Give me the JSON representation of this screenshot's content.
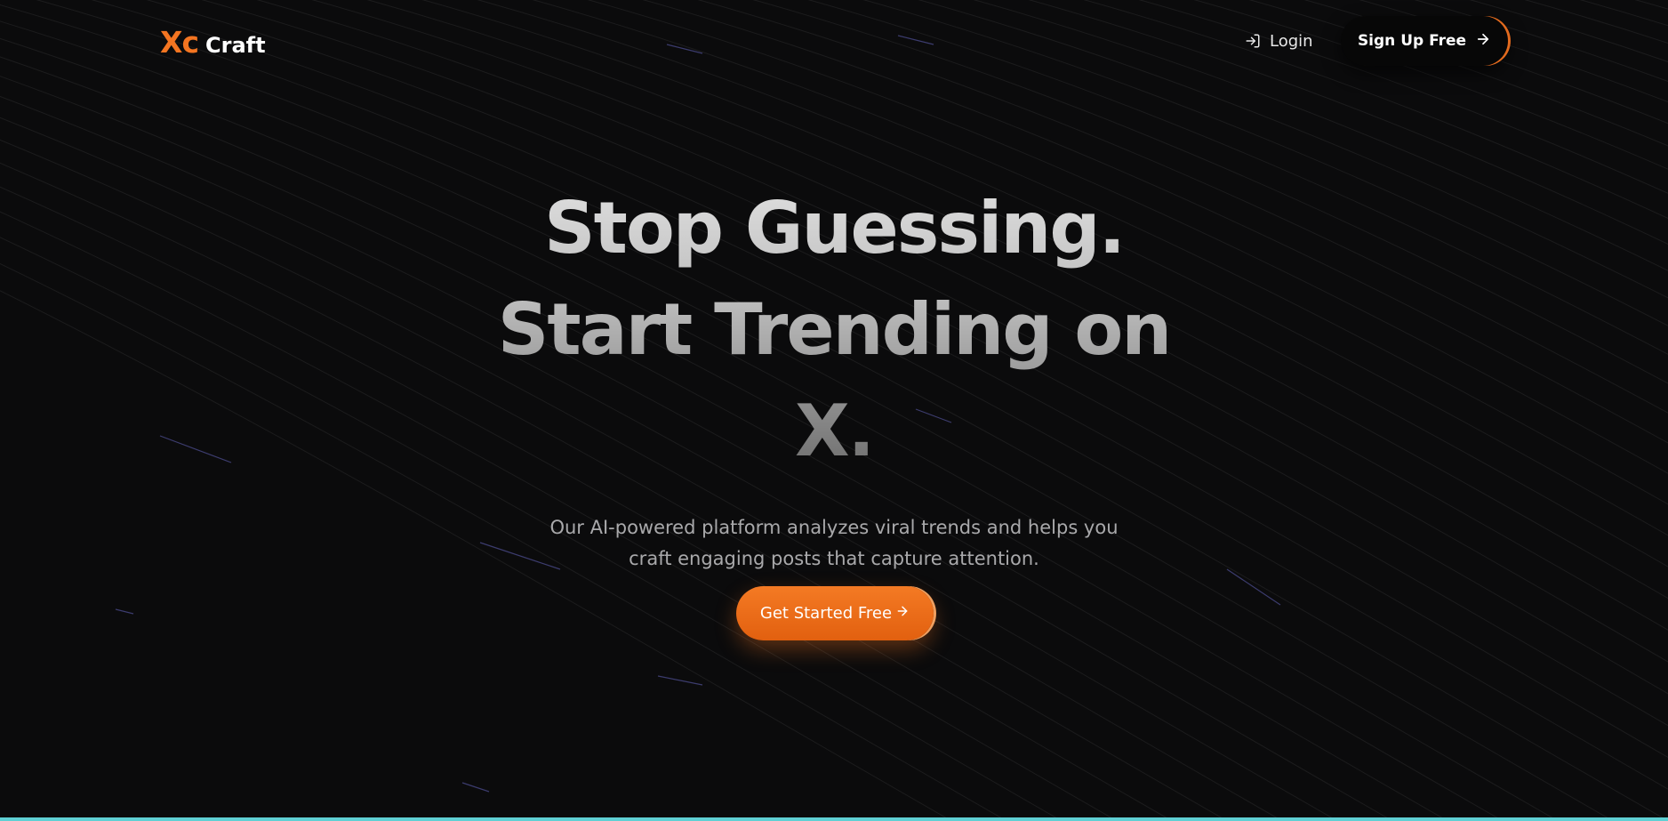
{
  "nav": {
    "logo_mark": "Xc",
    "logo_text": "Craft",
    "login_label": "Login",
    "signup_label": "Sign Up Free"
  },
  "hero": {
    "title_line1": "Stop Guessing.",
    "title_line2": "Start Trending on",
    "title_line3": "X.",
    "subtitle_line1": "Our AI-powered platform analyzes viral trends and helps you",
    "subtitle_line2": "craft engaging posts that capture attention.",
    "cta_label": "Get Started Free"
  },
  "colors": {
    "accent": "#f47521",
    "background": "#0b0b0c",
    "bottom_bar": "#5fd0d4"
  },
  "icons": {
    "login": "login-arrow-icon",
    "signup": "arrow-right-icon",
    "cta": "arrow-right-icon"
  }
}
